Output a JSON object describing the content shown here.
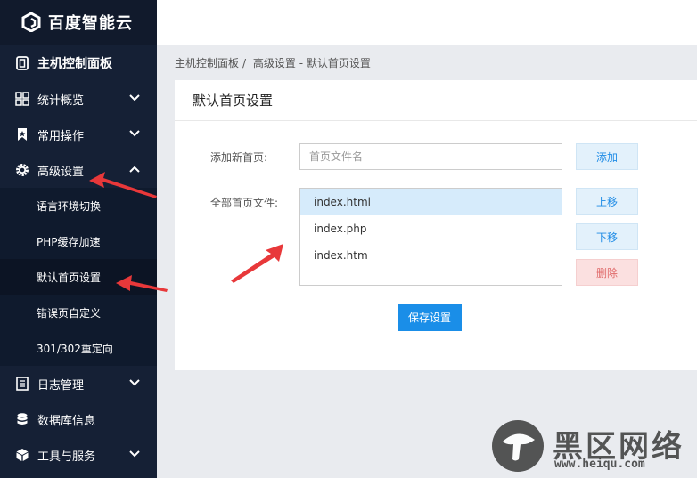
{
  "brand": {
    "name": "百度智能云"
  },
  "sidebar": {
    "items": [
      {
        "label": "主机控制面板",
        "icon": "dashboard-icon"
      },
      {
        "label": "统计概览",
        "icon": "grid-icon"
      },
      {
        "label": "常用操作",
        "icon": "bookmark-icon"
      },
      {
        "label": "高级设置",
        "icon": "gear-icon"
      },
      {
        "label": "日志管理",
        "icon": "list-icon"
      },
      {
        "label": "数据库信息",
        "icon": "database-icon"
      },
      {
        "label": "工具与服务",
        "icon": "cube-icon"
      }
    ],
    "sub_items": [
      {
        "label": "语言环境切换"
      },
      {
        "label": "PHP缓存加速"
      },
      {
        "label": "默认首页设置"
      },
      {
        "label": "错误页自定义"
      },
      {
        "label": "301/302重定向"
      }
    ]
  },
  "breadcrumb": {
    "home": "主机控制面板",
    "sep": "/",
    "current": "高级设置 - 默认首页设置"
  },
  "panel": {
    "title": "默认首页设置",
    "add_label": "添加新首页:",
    "add_placeholder": "首页文件名",
    "add_button": "添加",
    "all_label": "全部首页文件:",
    "files": [
      "index.html",
      "index.php",
      "index.htm"
    ],
    "up_button": "上移",
    "down_button": "下移",
    "delete_button": "删除",
    "save_button": "保存设置"
  },
  "watermark": {
    "title": "黑区网络",
    "url": "www.heiqu.com"
  },
  "colors": {
    "sidebar_bg": "#152035",
    "accent": "#1a8ee8",
    "arrow": "#e8383a",
    "danger": "#e06b6b"
  }
}
